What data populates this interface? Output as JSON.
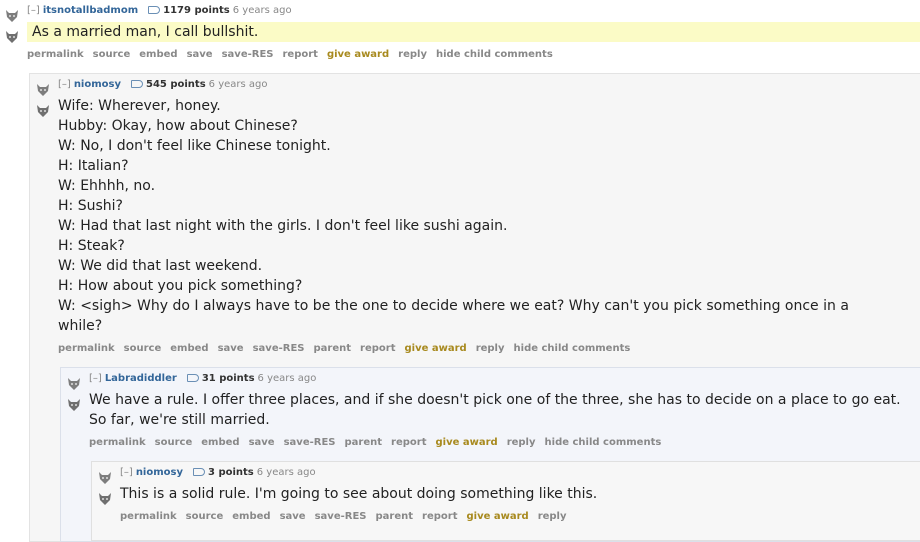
{
  "comments": [
    {
      "expand": "[–]",
      "author": "itsnotallbadmom",
      "score": "1179 points",
      "time": "6 years ago",
      "body": [
        "As a married man, I call bullshit."
      ],
      "buttons": [
        "permalink",
        "source",
        "embed",
        "save",
        "save-RES",
        "report",
        "give award",
        "reply",
        "hide child comments"
      ]
    },
    {
      "expand": "[–]",
      "author": "niomosy",
      "score": "545 points",
      "time": "6 years ago",
      "body": [
        "Wife: Wherever, honey.",
        "Hubby: Okay, how about Chinese?",
        "W: No, I don't feel like Chinese tonight.",
        "H: Italian?",
        "W: Ehhhh, no.",
        "H: Sushi?",
        "W: Had that last night with the girls. I don't feel like sushi again.",
        "H: Steak?",
        "W: We did that last weekend.",
        "H: How about you pick something?",
        "W: <sigh> Why do I always have to be the one to decide where we eat? Why can't you pick something once in a while?"
      ],
      "buttons": [
        "permalink",
        "source",
        "embed",
        "save",
        "save-RES",
        "parent",
        "report",
        "give award",
        "reply",
        "hide child comments"
      ]
    },
    {
      "expand": "[–]",
      "author": "Labradiddler",
      "score": "31 points",
      "time": "6 years ago",
      "body": [
        "We have a rule. I offer three places, and if she doesn't pick one of the three, she has to decide on a place to go eat. So far, we're still married."
      ],
      "buttons": [
        "permalink",
        "source",
        "embed",
        "save",
        "save-RES",
        "parent",
        "report",
        "give award",
        "reply",
        "hide child comments"
      ]
    },
    {
      "expand": "[–]",
      "author": "niomosy",
      "score": "3 points",
      "time": "6 years ago",
      "body": [
        "This is a solid rule. I'm going to see about doing something like this."
      ],
      "buttons": [
        "permalink",
        "source",
        "embed",
        "save",
        "save-RES",
        "parent",
        "report",
        "give award",
        "reply"
      ]
    }
  ],
  "colors": {
    "author": "#336699",
    "award": "#a88a1f",
    "highlight": "#fbfbc6",
    "meta": "#888888"
  },
  "icons": {
    "avatar": "wolf-avatar-icon",
    "score": "score-tag-icon"
  }
}
